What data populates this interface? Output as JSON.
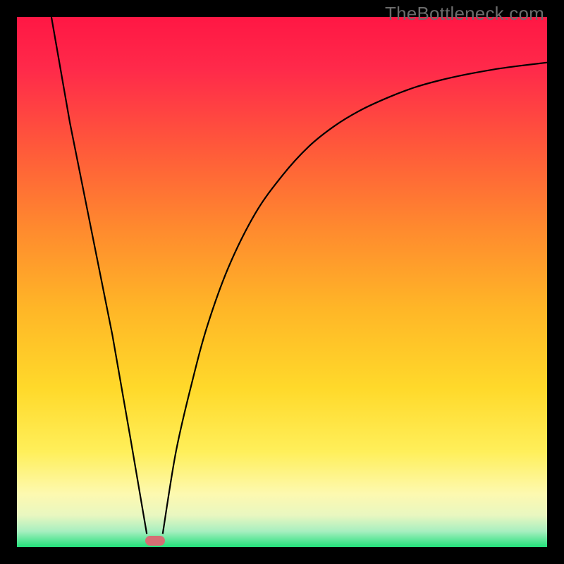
{
  "watermark": "TheBottleneck.com",
  "chart_data": {
    "type": "line",
    "title": "",
    "xlabel": "",
    "ylabel": "",
    "xlim": [
      0,
      1
    ],
    "ylim": [
      0,
      1
    ],
    "background_gradient": {
      "stops": [
        {
          "y": 0.0,
          "color": "#ff1744"
        },
        {
          "y": 0.1,
          "color": "#ff2a4a"
        },
        {
          "y": 0.25,
          "color": "#ff5a3a"
        },
        {
          "y": 0.4,
          "color": "#ff8a2e"
        },
        {
          "y": 0.55,
          "color": "#ffb627"
        },
        {
          "y": 0.7,
          "color": "#ffd92a"
        },
        {
          "y": 0.82,
          "color": "#ffef5a"
        },
        {
          "y": 0.9,
          "color": "#fdf9b0"
        },
        {
          "y": 0.94,
          "color": "#e9f7c0"
        },
        {
          "y": 0.97,
          "color": "#a8efc0"
        },
        {
          "y": 1.0,
          "color": "#22e07a"
        }
      ]
    },
    "series": [
      {
        "name": "left-branch",
        "x": [
          0.065,
          0.1,
          0.14,
          0.18,
          0.215,
          0.245
        ],
        "y": [
          1.0,
          0.8,
          0.6,
          0.4,
          0.2,
          0.025
        ]
      },
      {
        "name": "right-branch",
        "x": [
          0.275,
          0.3,
          0.33,
          0.36,
          0.4,
          0.45,
          0.5,
          0.55,
          0.6,
          0.65,
          0.7,
          0.75,
          0.8,
          0.85,
          0.9,
          0.95,
          1.0
        ],
        "y": [
          0.025,
          0.18,
          0.31,
          0.42,
          0.53,
          0.63,
          0.7,
          0.755,
          0.795,
          0.825,
          0.848,
          0.867,
          0.881,
          0.892,
          0.901,
          0.908,
          0.914
        ]
      }
    ],
    "marker": {
      "x": 0.26,
      "y": 0.012,
      "color": "#d66e74"
    }
  }
}
